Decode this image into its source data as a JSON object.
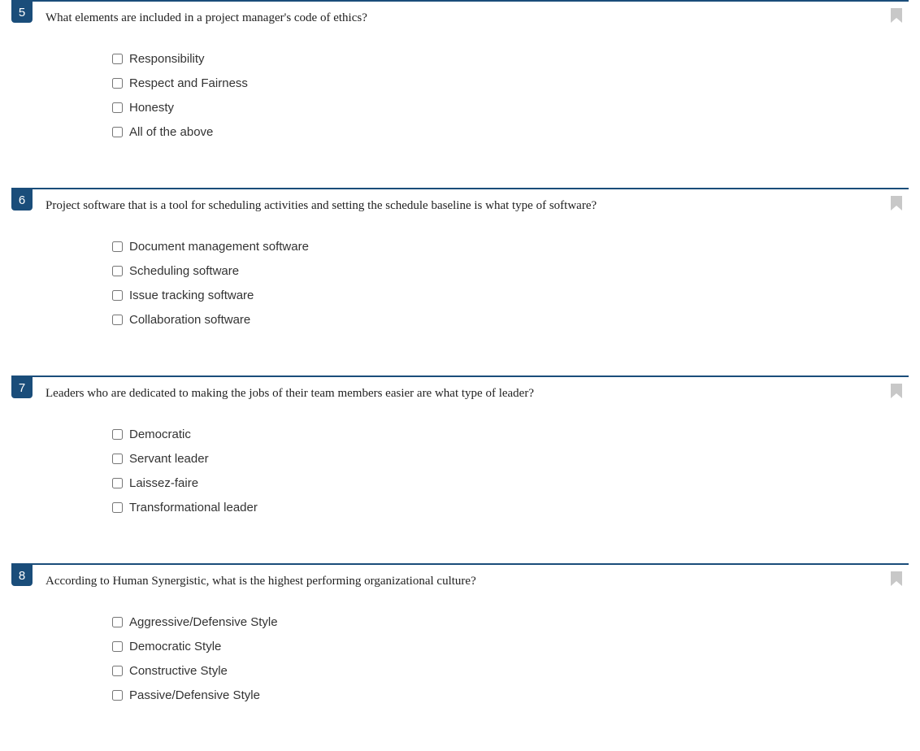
{
  "questions": [
    {
      "number": "5",
      "text": "What elements are included in a project manager's code of ethics?",
      "options": [
        "Responsibility",
        "Respect and Fairness",
        "Honesty",
        "All of the above"
      ]
    },
    {
      "number": "6",
      "text": "Project software that is a tool for scheduling activities and setting the schedule baseline is what type of software?",
      "options": [
        "Document management software",
        "Scheduling software",
        "Issue tracking software",
        "Collaboration software"
      ]
    },
    {
      "number": "7",
      "text": "Leaders who are dedicated to making the jobs of their team members easier are what type of leader?",
      "options": [
        "Democratic",
        "Servant leader",
        "Laissez-faire",
        "Transformational leader"
      ]
    },
    {
      "number": "8",
      "text": "According to Human Synergistic, what is the highest performing organizational culture?",
      "options": [
        "Aggressive/Defensive Style",
        "Democratic Style",
        "Constructive Style",
        "Passive/Defensive Style"
      ]
    }
  ]
}
